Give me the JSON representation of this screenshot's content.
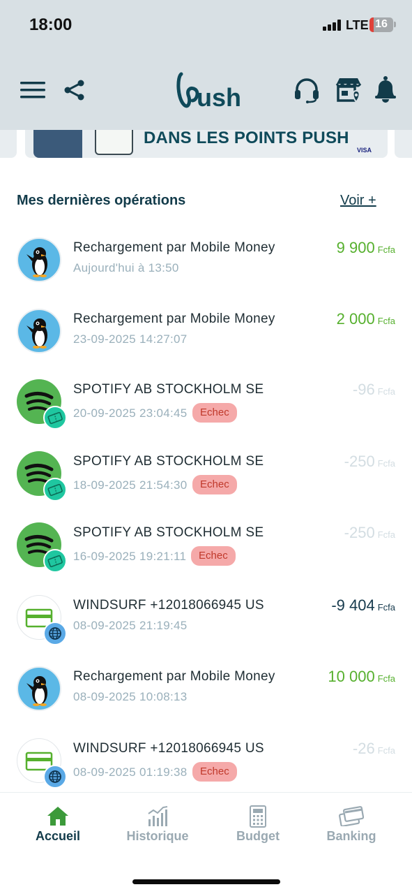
{
  "status_bar": {
    "time": "18:00",
    "network": "LTE",
    "battery": "16"
  },
  "header": {
    "logo_text": "push"
  },
  "banner": {
    "text": "DANS LES POINTS PUSH",
    "card_brand": "VISA"
  },
  "section": {
    "title": "Mes dernières opérations",
    "see_more": "Voir +"
  },
  "transactions": [
    {
      "title": "Rechargement par Mobile Money",
      "date": "Aujourd'hui à 13:50",
      "amount": "9 900",
      "currency": "Fcfa",
      "status": "",
      "icon": "penguin-icon",
      "amount_style": "green"
    },
    {
      "title": "Rechargement par Mobile Money",
      "date": "23-09-2025 14:27:07",
      "amount": "2 000",
      "currency": "Fcfa",
      "status": "",
      "icon": "penguin-icon",
      "amount_style": "green"
    },
    {
      "title": "SPOTIFY AB STOCKHOLM SE",
      "date": "20-09-2025 23:04:45",
      "amount": "-96",
      "currency": "Fcfa",
      "status": "Echec",
      "icon": "spotify-icon",
      "amount_style": "faded"
    },
    {
      "title": "SPOTIFY AB STOCKHOLM SE",
      "date": "18-09-2025 21:54:30",
      "amount": "-250",
      "currency": "Fcfa",
      "status": "Echec",
      "icon": "spotify-icon",
      "amount_style": "faded"
    },
    {
      "title": "SPOTIFY AB STOCKHOLM SE",
      "date": "16-09-2025 19:21:11",
      "amount": "-250",
      "currency": "Fcfa",
      "status": "Echec",
      "icon": "spotify-icon",
      "amount_style": "faded"
    },
    {
      "title": "WINDSURF +12018066945 US",
      "date": "08-09-2025 21:19:45",
      "amount": "-9 404",
      "currency": "Fcfa",
      "status": "",
      "icon": "card-icon",
      "amount_style": "dark"
    },
    {
      "title": "Rechargement par Mobile Money",
      "date": "08-09-2025 10:08:13",
      "amount": "10 000",
      "currency": "Fcfa",
      "status": "",
      "icon": "penguin-icon",
      "amount_style": "green"
    },
    {
      "title": "WINDSURF +12018066945 US",
      "date": "08-09-2025 01:19:38",
      "amount": "-26",
      "currency": "Fcfa",
      "status": "Echec",
      "icon": "card-icon",
      "amount_style": "faded"
    }
  ],
  "bottom_nav": [
    {
      "label": "Accueil",
      "icon": "home-icon",
      "active": true
    },
    {
      "label": "Historique",
      "icon": "chart-icon",
      "active": false
    },
    {
      "label": "Budget",
      "icon": "calculator-icon",
      "active": false
    },
    {
      "label": "Banking",
      "icon": "cards-icon",
      "active": false
    }
  ],
  "colors": {
    "primary": "#123b4a",
    "positive": "#56b02e",
    "failed_badge": "#f5a9a9",
    "header_bg": "#d8e0e4"
  }
}
